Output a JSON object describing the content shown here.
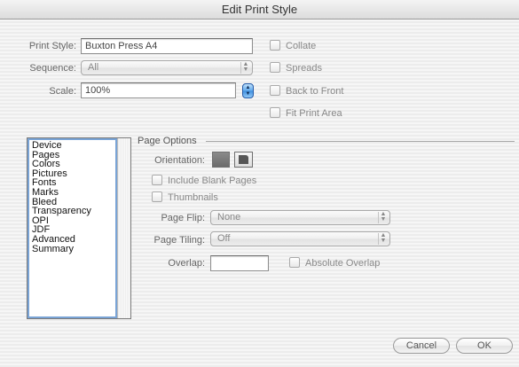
{
  "window": {
    "title": "Edit Print Style"
  },
  "form": {
    "print_style_label": "Print Style:",
    "print_style_value": "Buxton Press A4",
    "sequence_label": "Sequence:",
    "sequence_value": "All",
    "scale_label": "Scale:",
    "scale_value": "100%"
  },
  "options": {
    "collate": "Collate",
    "spreads": "Spreads",
    "back_to_front": "Back to Front",
    "fit_print_area": "Fit Print Area"
  },
  "sidebar": {
    "items": [
      "Device",
      "Pages",
      "Colors",
      "Pictures",
      "Fonts",
      "Marks",
      "Bleed",
      "Transparency",
      "OPI",
      "JDF",
      "Advanced",
      "Summary"
    ]
  },
  "page_options": {
    "group_label": "Page Options",
    "orientation_label": "Orientation:",
    "include_blank_pages": "Include Blank Pages",
    "thumbnails": "Thumbnails",
    "page_flip_label": "Page Flip:",
    "page_flip_value": "None",
    "page_tiling_label": "Page Tiling:",
    "page_tiling_value": "Off",
    "overlap_label": "Overlap:",
    "overlap_value": "",
    "absolute_overlap": "Absolute Overlap"
  },
  "buttons": {
    "cancel": "Cancel",
    "ok": "OK"
  },
  "colors": {
    "focus_blue": "#7aa4d6",
    "stepper_blue": "#5ea8ec"
  },
  "icons": {
    "popup_arrows": "up-down-arrows-icon",
    "orientation_portrait": "portrait-icon",
    "orientation_landscape": "landscape-icon"
  }
}
